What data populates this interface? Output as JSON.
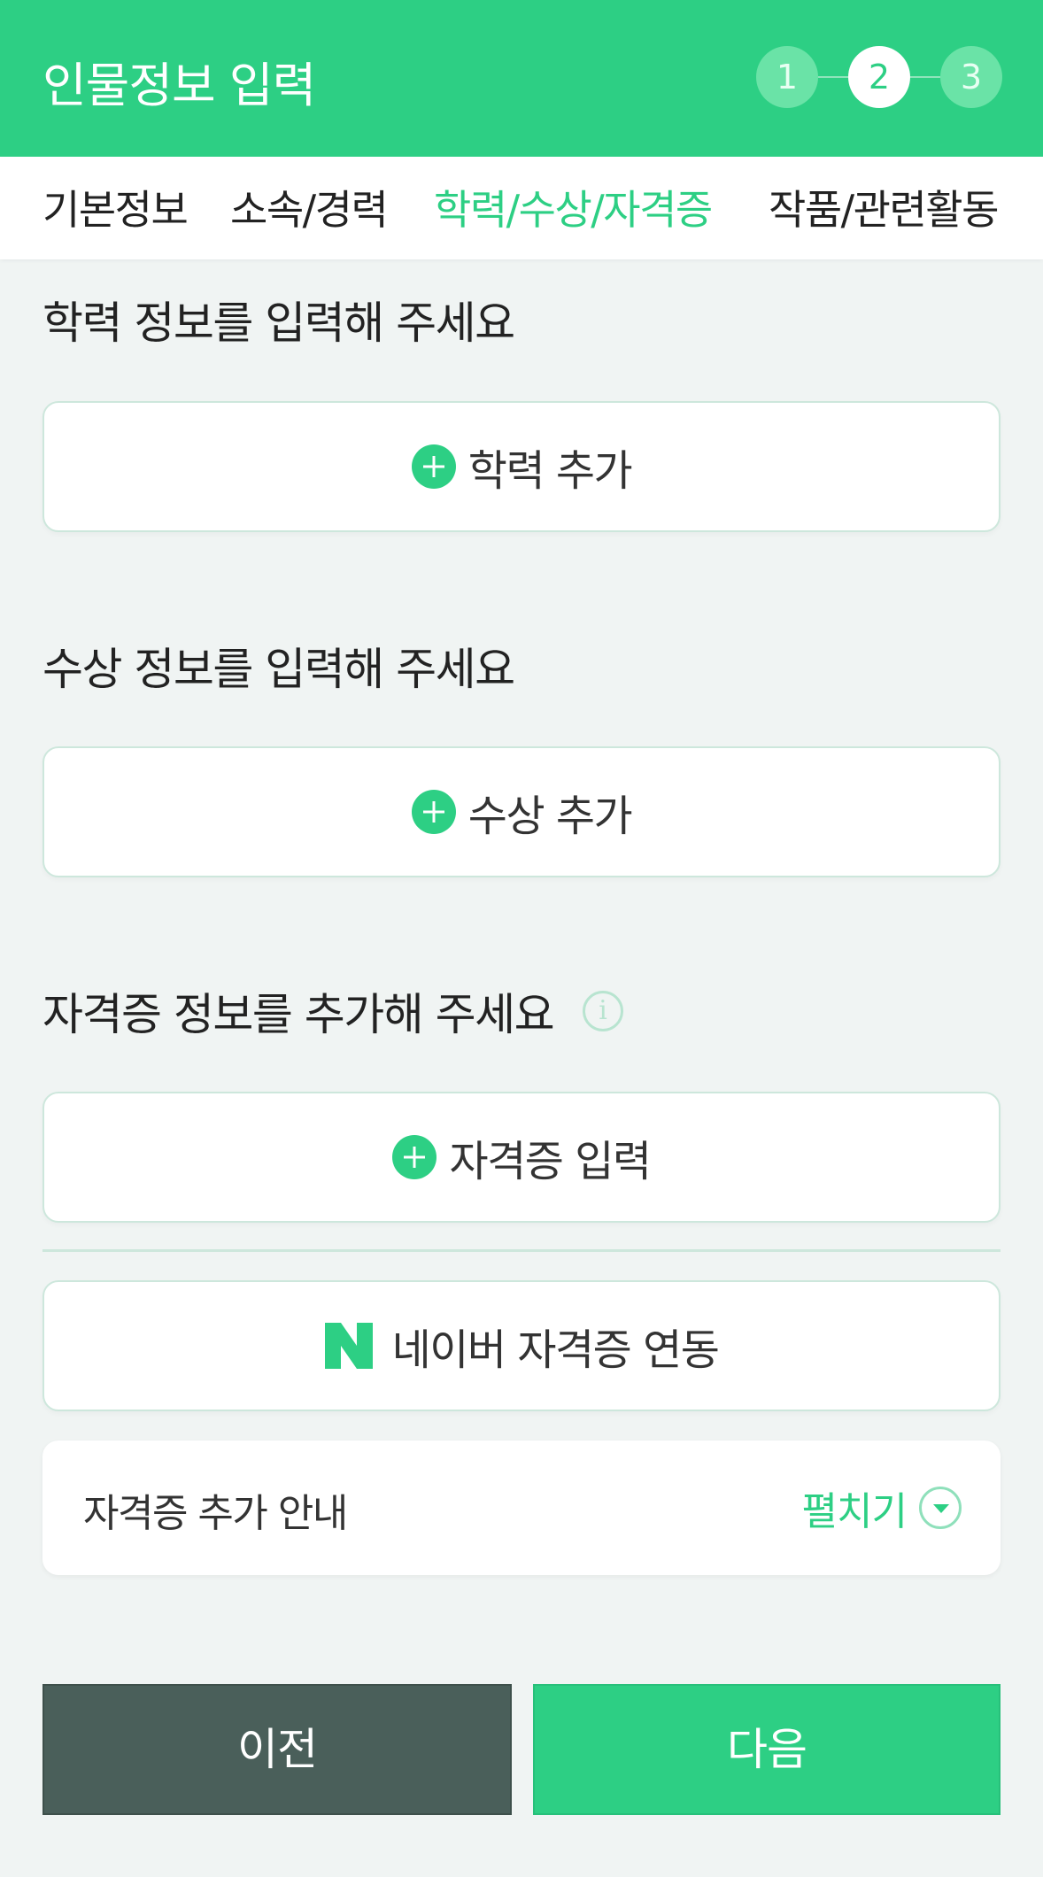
{
  "header": {
    "title": "인물정보 입력",
    "steps": [
      "1",
      "2",
      "3"
    ],
    "active_step": "2"
  },
  "tabs": [
    {
      "label": "기본정보",
      "active": false
    },
    {
      "label": "소속/경력",
      "active": false
    },
    {
      "label": "학력/수상/자격증",
      "active": true
    },
    {
      "label": "작품/관련활동",
      "active": false
    }
  ],
  "education": {
    "title": "학력 정보를 입력해 주세요",
    "add_label": "학력 추가",
    "icon": "plus-circle-icon"
  },
  "awards": {
    "title": "수상 정보를 입력해 주세요",
    "add_label": "수상 추가",
    "icon": "plus-circle-icon"
  },
  "certificates": {
    "title": "자격증 정보를 추가해 주세요",
    "info_icon": "info-icon",
    "info_glyph": "i",
    "add_label": "자격증 입력",
    "naver_label": "네이버 자격증 연동",
    "naver_icon": "naver-n-icon",
    "guide_label": "자격증 추가 안내",
    "expand_label": "펼치기",
    "expand_icon": "chevron-down-circle-icon"
  },
  "footer": {
    "prev_label": "이전",
    "next_label": "다음"
  },
  "colors": {
    "accent": "#2dcf84",
    "background": "#f0f4f3",
    "prev_button": "#4a5f5a"
  }
}
